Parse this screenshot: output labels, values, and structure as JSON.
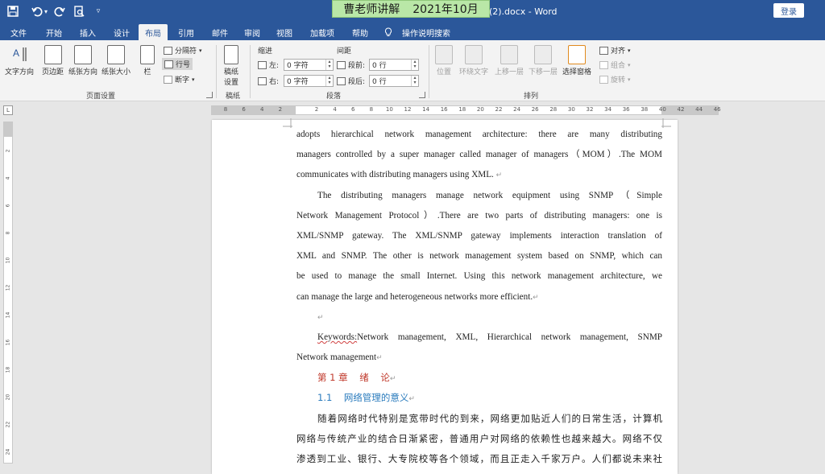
{
  "titlebar": {
    "doc_title": "本 (2).docx  -  Word",
    "login_label": "登录",
    "overlay_left": "曹老师讲解",
    "overlay_right": "2021年10月"
  },
  "tabs": [
    "文件",
    "开始",
    "插入",
    "设计",
    "布局",
    "引用",
    "邮件",
    "审阅",
    "视图",
    "加载项",
    "帮助",
    "操作说明搜索"
  ],
  "active_tab": "布局",
  "ribbon": {
    "page_setup": {
      "text_direction": "文字方向",
      "margins": "页边距",
      "orientation": "纸张方向",
      "size": "纸张大小",
      "columns": "栏",
      "breaks": "分隔符",
      "line_numbers": "行号",
      "hyphenation": "断字",
      "group_label": "页面设置"
    },
    "manuscript": {
      "button": "稿纸设置",
      "button_line1": "稿纸",
      "button_line2": "设置",
      "group_label": "稿纸"
    },
    "paragraph": {
      "indent_header": "缩进",
      "spacing_header": "间距",
      "left_label": "左:",
      "right_label": "右:",
      "before_label": "段前:",
      "after_label": "段后:",
      "left_value": "0 字符",
      "right_value": "0 字符",
      "before_value": "0 行",
      "after_value": "0 行",
      "group_label": "段落"
    },
    "arrange": {
      "position": "位置",
      "wrap_text": "环绕文字",
      "bring_forward": "上移一层",
      "send_backward": "下移一层",
      "selection_pane": "选择窗格",
      "align": "对齐",
      "group": "组合",
      "rotate": "旋转",
      "group_label": "排列"
    }
  },
  "ruler": {
    "h_numbers": [
      "8",
      "6",
      "4",
      "2",
      "",
      "2",
      "4",
      "6",
      "8",
      "10",
      "12",
      "14",
      "16",
      "18",
      "20",
      "22",
      "24",
      "26",
      "28",
      "30",
      "32",
      "34",
      "36",
      "38",
      "40",
      "42",
      "44",
      "46"
    ],
    "v_numbers": [
      "2",
      "4",
      "6",
      "8",
      "10",
      "12",
      "14",
      "16",
      "18",
      "20",
      "22",
      "24"
    ],
    "corner": "L"
  },
  "document": {
    "lines": [
      "adopts hierarchical network management architecture: there are many distributing",
      "managers controlled by a super manager called manager of managers（MOM）.The MOM",
      "communicates with distributing managers using XML. ",
      "The distributing managers manage network equipment using SNMP（Simple",
      "Network Management Protocol）.There are two parts of distributing managers: one is",
      "XML/SNMP gateway. The XML/SNMP gateway implements interaction translation of",
      "XML and SNMP. The other is network management system based on SNMP, which can",
      "be used to manage the small Internet. Using this network management architecture, we",
      "can manage the large and heterogeneous networks more efficient."
    ],
    "keywords_prefix": "Keywords:",
    "keywords_line1": "Network management, XML, Hierarchical network management, SNMP",
    "keywords_line2": "Network management",
    "chapter_heading": "第 1 章    绪    论",
    "section_heading": "1.1    网络管理的意义",
    "cn_lines": [
      "随着网络时代特别是宽带时代的到来，网络更加贴近人们的日常生活，计算机",
      "网络与传统产业的结合日渐紧密，普通用户对网络的依赖性也越来越大。网络不仅",
      "渗透到工业、银行、大专院校等各个领域，而且正走入千家万户。人们都说未来社"
    ],
    "pilcrow": "↵"
  }
}
